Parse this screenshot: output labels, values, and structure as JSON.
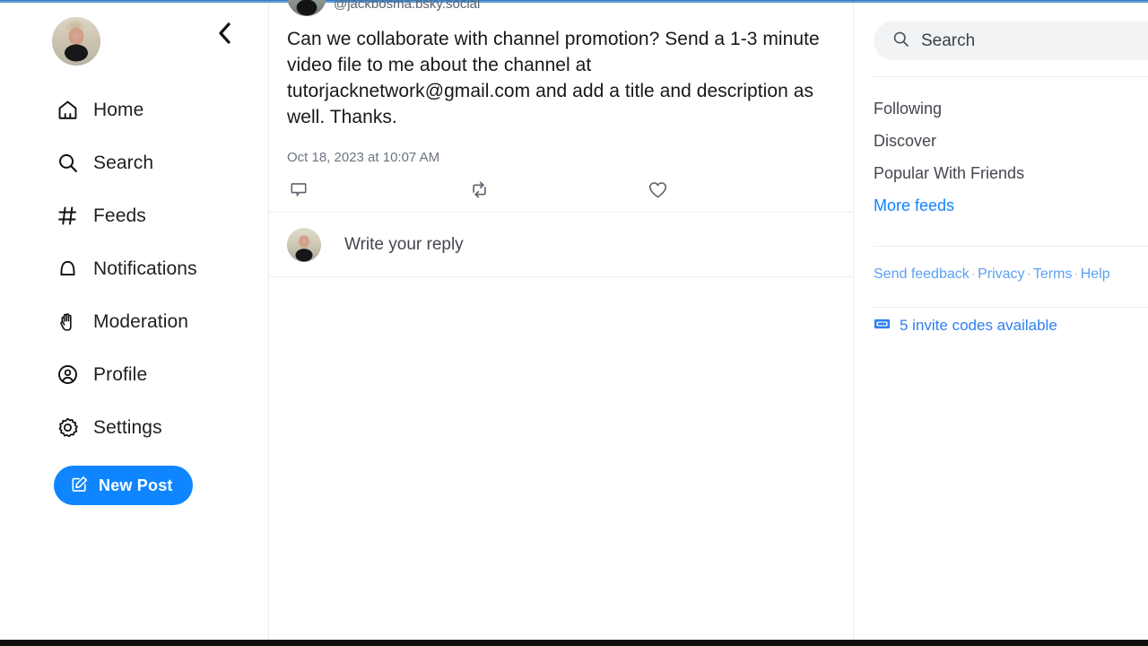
{
  "theme": {
    "accent": "#0f86ff",
    "link": "#1083fe",
    "text_primary": "#16181c",
    "text_muted": "#6b7480",
    "divider": "#ebedf0",
    "search_bg": "#f1f3f5",
    "top_strip": "#5b9bd5",
    "bottom_strip": "#0e0e0e"
  },
  "sidebar": {
    "avatar_name": "user-avatar",
    "back_icon": "chevron-left-icon",
    "items": [
      {
        "icon": "home-icon",
        "label": "Home"
      },
      {
        "icon": "search-icon",
        "label": "Search"
      },
      {
        "icon": "hash-icon",
        "label": "Feeds"
      },
      {
        "icon": "bell-icon",
        "label": "Notifications"
      },
      {
        "icon": "hand-icon",
        "label": "Moderation"
      },
      {
        "icon": "person-circle-icon",
        "label": "Profile"
      },
      {
        "icon": "gear-icon",
        "label": "Settings"
      }
    ],
    "new_post": {
      "label": "New Post",
      "icon": "compose-icon"
    }
  },
  "post": {
    "handle": "@jackbosma.bsky.social",
    "text": "Can we collaborate with channel promotion?  Send a 1-3 minute video file to me about the channel at tutorjacknetwork@gmail.com and add a title and description as well. Thanks.",
    "timestamp": "Oct 18, 2023 at 10:07 AM",
    "actions": [
      {
        "name": "reply-icon",
        "count": ""
      },
      {
        "name": "repost-icon",
        "count": ""
      },
      {
        "name": "like-icon",
        "count": ""
      }
    ]
  },
  "reply": {
    "placeholder": "Write your reply",
    "avatar_name": "user-avatar"
  },
  "right": {
    "search": {
      "placeholder": "Search",
      "icon": "search-icon"
    },
    "feeds": [
      {
        "label": "Following",
        "is_link": false
      },
      {
        "label": "Discover",
        "is_link": false
      },
      {
        "label": "Popular With Friends",
        "is_link": false
      },
      {
        "label": "More feeds",
        "is_link": true
      }
    ],
    "legal": [
      "Send feedback",
      "Privacy",
      "Terms",
      "Help"
    ],
    "legal_separator": "·",
    "invites": {
      "label": "5 invite codes available",
      "icon": "ticket-icon"
    }
  }
}
